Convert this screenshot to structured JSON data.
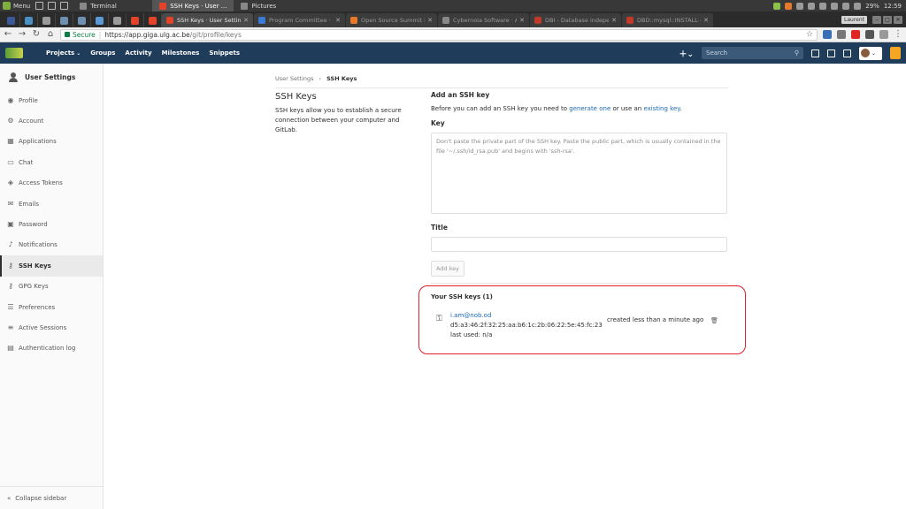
{
  "os": {
    "menu_label": "Menu",
    "tasks": [
      {
        "label": "Terminal",
        "active": false
      },
      {
        "label": "SSH Keys · User ...",
        "active": true
      },
      {
        "label": "Pictures",
        "active": false
      }
    ],
    "tray": {
      "battery": "29%",
      "clock": "12:59",
      "user_label": "Laurent"
    }
  },
  "browser": {
    "tabs": [
      {
        "label": "SSH Keys · User Settings",
        "active": true,
        "favicon_color": "#e24329"
      },
      {
        "label": "Program Committee · O",
        "active": false,
        "favicon_color": "#3a7bd5"
      },
      {
        "label": "Open Source Summit E",
        "active": false,
        "favicon_color": "#e8792b"
      },
      {
        "label": "Cybernoia Software · A",
        "active": false,
        "favicon_color": "#888888"
      },
      {
        "label": "DBI - Database indepe",
        "active": false,
        "favicon_color": "#c0392b"
      },
      {
        "label": "DBD::mysql::INSTALL -",
        "active": false,
        "favicon_color": "#c0392b"
      }
    ],
    "window_controls": {
      "min": "–",
      "max": "□",
      "close": "✕"
    },
    "address": {
      "secure_label": "Secure",
      "url_host": "https://app.giga.ulg.ac.be",
      "url_path": "/git/profile/keys"
    }
  },
  "header": {
    "nav": [
      {
        "label": "Projects",
        "has_dropdown": true
      },
      {
        "label": "Groups",
        "has_dropdown": false
      },
      {
        "label": "Activity",
        "has_dropdown": false
      },
      {
        "label": "Milestones",
        "has_dropdown": false
      },
      {
        "label": "Snippets",
        "has_dropdown": false
      }
    ],
    "search_placeholder": "Search"
  },
  "sidebar": {
    "title": "User Settings",
    "items": [
      {
        "label": "Profile",
        "icon": "profile-icon",
        "active": false
      },
      {
        "label": "Account",
        "icon": "account-icon",
        "active": false
      },
      {
        "label": "Applications",
        "icon": "applications-icon",
        "active": false
      },
      {
        "label": "Chat",
        "icon": "chat-icon",
        "active": false
      },
      {
        "label": "Access Tokens",
        "icon": "token-icon",
        "active": false
      },
      {
        "label": "Emails",
        "icon": "email-icon",
        "active": false
      },
      {
        "label": "Password",
        "icon": "lock-icon",
        "active": false
      },
      {
        "label": "Notifications",
        "icon": "bell-icon",
        "active": false
      },
      {
        "label": "SSH Keys",
        "icon": "key-icon",
        "active": true
      },
      {
        "label": "GPG Keys",
        "icon": "key-icon",
        "active": false
      },
      {
        "label": "Preferences",
        "icon": "sliders-icon",
        "active": false
      },
      {
        "label": "Active Sessions",
        "icon": "sessions-icon",
        "active": false
      },
      {
        "label": "Authentication log",
        "icon": "log-icon",
        "active": false
      }
    ],
    "collapse_label": "Collapse sidebar"
  },
  "breadcrumb": {
    "parent": "User Settings",
    "separator": "›",
    "current": "SSH Keys"
  },
  "intro": {
    "title": "SSH Keys",
    "description": "SSH keys allow you to establish a secure connection between your computer and GitLab."
  },
  "form": {
    "heading": "Add an SSH key",
    "help_prefix": "Before you can add an SSH key you need to",
    "help_link1": "generate one",
    "help_middle": "or use an",
    "help_link2": "existing key",
    "help_suffix": ".",
    "key_label": "Key",
    "key_placeholder": "Don't paste the private part of the SSH key. Paste the public part, which is usually contained in the file '~/.ssh/id_rsa.pub' and begins with 'ssh-rsa'.",
    "title_label": "Title",
    "title_value": "",
    "submit_label": "Add key"
  },
  "keys": {
    "heading": "Your SSH keys (1)",
    "items": [
      {
        "title": "i.am@nob.od",
        "fingerprint": "d5:a3:46:2f:32:25:aa:b6:1c:2b:06:22:5e:45:fc:23",
        "last_used": "last used: n/a",
        "created": "created less than a minute ago",
        "delete_icon": "trash-icon"
      }
    ]
  },
  "colors": {
    "header_bg": "#1f3c5a",
    "link": "#1b69b6",
    "highlight_border": "#e01e2a"
  }
}
